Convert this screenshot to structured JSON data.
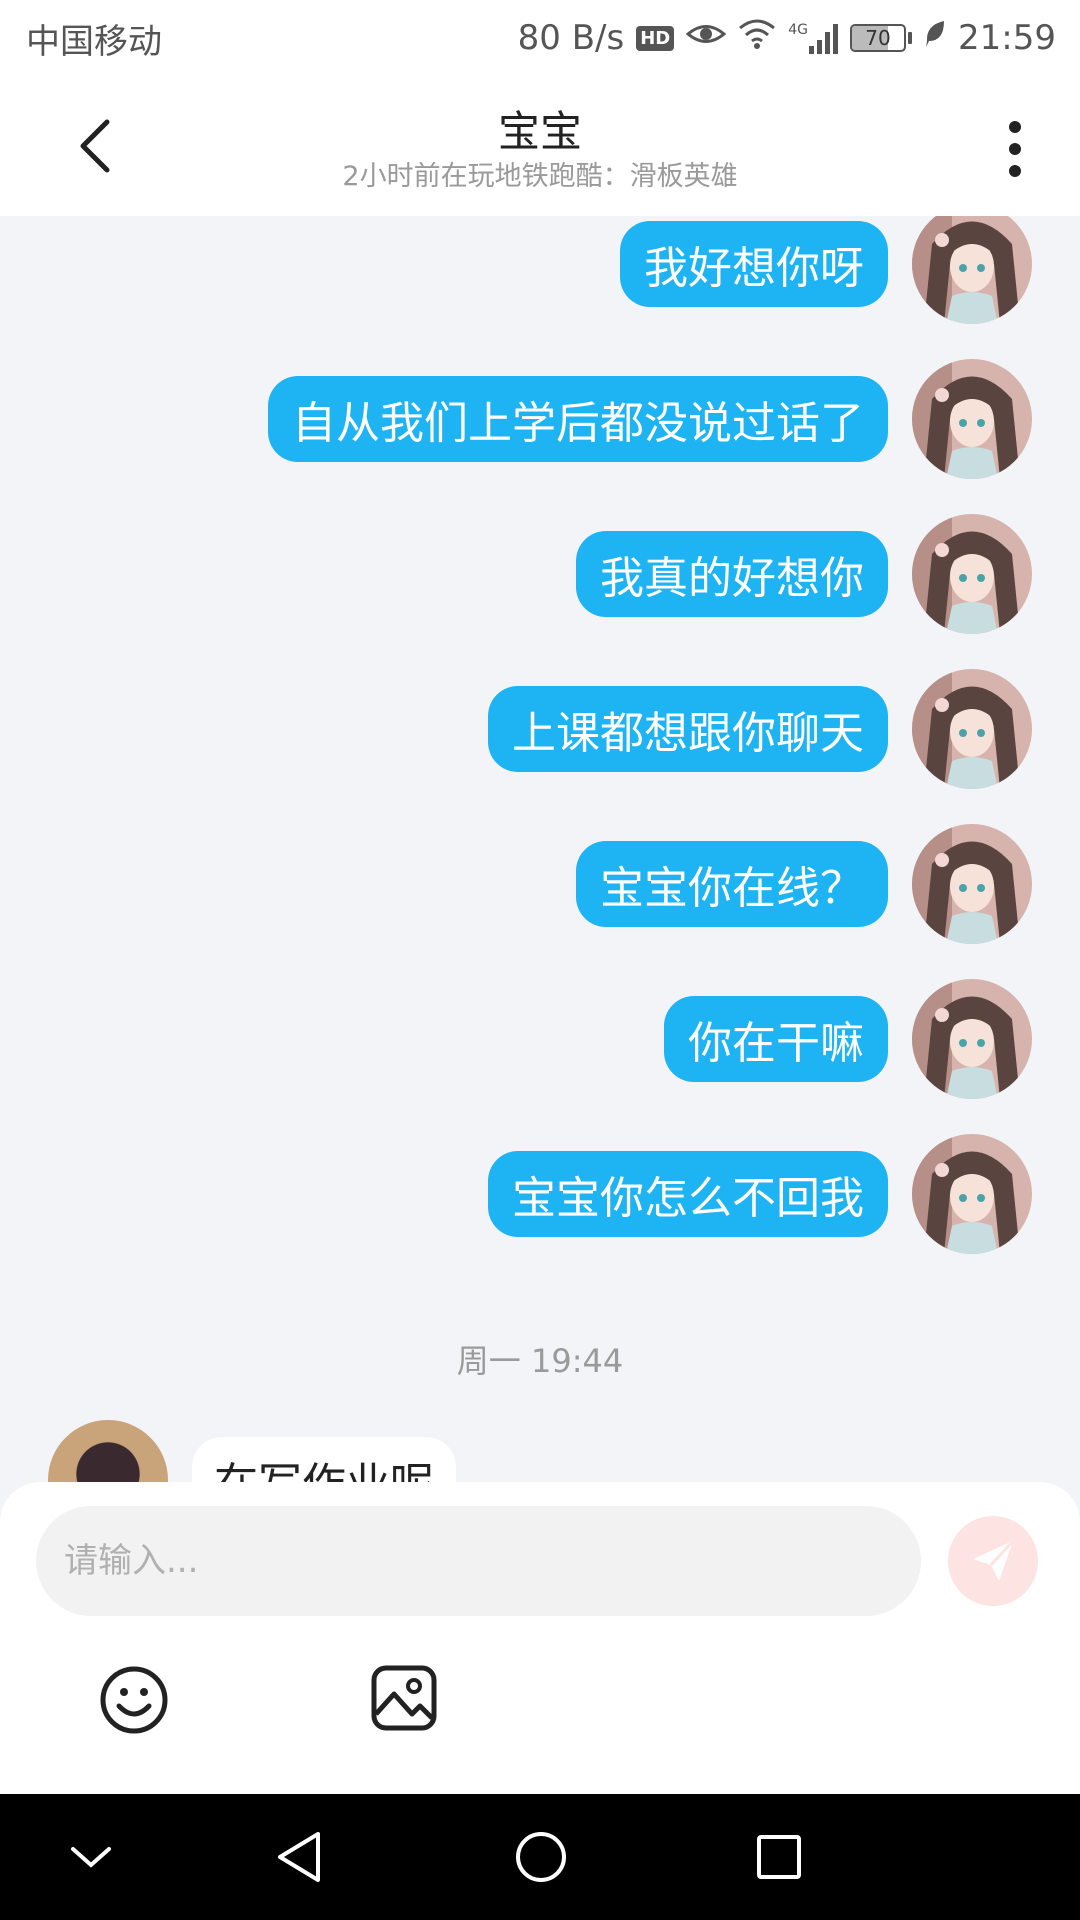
{
  "status_bar": {
    "carrier": "中国移动",
    "speed": "80 B/s",
    "hd": "HD",
    "signal_type": "4G",
    "battery": "70",
    "battery_level": 0.7,
    "time": "21:59"
  },
  "header": {
    "title": "宝宝",
    "subtitle": "2小时前在玩地铁跑酷：滑板英雄",
    "back_icon": "chevron-left-icon",
    "more_icon": "more-vertical-icon"
  },
  "messages": {
    "outgoing": [
      {
        "text": "我好想你呀"
      },
      {
        "text": "自从我们上学后都没说过话了"
      },
      {
        "text": "我真的好想你"
      },
      {
        "text": "上课都想跟你聊天"
      },
      {
        "text": "宝宝你在线？"
      },
      {
        "text": "你在干嘛"
      },
      {
        "text": "宝宝你怎么不回我"
      }
    ],
    "timestamp": "周一 19:44",
    "incoming": [
      {
        "text": "在写作业呢"
      }
    ]
  },
  "composer": {
    "placeholder": "请输入...",
    "send_icon": "send-icon",
    "emoji_icon": "emoji-icon",
    "image_icon": "image-icon"
  },
  "nav": {
    "icons": [
      "chevron-down-icon",
      "back-triangle-icon",
      "home-circle-icon",
      "recents-square-icon"
    ]
  },
  "colors": {
    "bubble_out": "#1eb3f2",
    "bubble_in": "#ffffff",
    "background": "#f3f4f7",
    "send_button_bg": "#fde3e2",
    "send_icon": "#ffffff"
  }
}
